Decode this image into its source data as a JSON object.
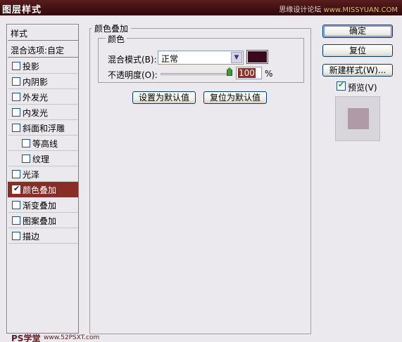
{
  "window": {
    "title": "图层样式",
    "watermark": "思缘设计论坛",
    "watermark_url": "www.MISSYUAN.COM"
  },
  "style_list": {
    "header": "样式",
    "blend_options": "混合选项:自定",
    "items": [
      {
        "label": "投影",
        "checked": false,
        "indent": false,
        "selected": false
      },
      {
        "label": "内阴影",
        "checked": false,
        "indent": false,
        "selected": false
      },
      {
        "label": "外发光",
        "checked": false,
        "indent": false,
        "selected": false
      },
      {
        "label": "内发光",
        "checked": false,
        "indent": false,
        "selected": false
      },
      {
        "label": "斜面和浮雕",
        "checked": false,
        "indent": false,
        "selected": false
      },
      {
        "label": "等高线",
        "checked": false,
        "indent": true,
        "selected": false
      },
      {
        "label": "纹理",
        "checked": false,
        "indent": true,
        "selected": false
      },
      {
        "label": "光泽",
        "checked": false,
        "indent": false,
        "selected": false
      },
      {
        "label": "颜色叠加",
        "checked": true,
        "indent": false,
        "selected": true
      },
      {
        "label": "渐变叠加",
        "checked": false,
        "indent": false,
        "selected": false
      },
      {
        "label": "图案叠加",
        "checked": false,
        "indent": false,
        "selected": false
      },
      {
        "label": "描边",
        "checked": false,
        "indent": false,
        "selected": false
      }
    ],
    "watermark_ps": "PS学堂",
    "watermark_site": "www.52PSXT.com"
  },
  "color_overlay": {
    "group_title": "颜色叠加",
    "color_group_title": "颜色",
    "blend_mode_label": "混合模式(B):",
    "blend_mode_value": "正常",
    "color": "#3a0a20",
    "opacity_label": "不透明度(O):",
    "opacity_value": "100",
    "opacity_unit": "%",
    "set_default_button": "设置为默认值",
    "reset_default_button": "复位为默认值"
  },
  "actions": {
    "ok": "确定",
    "reset": "复位",
    "new_style": "新建样式(W)...",
    "preview_label": "预览(V)",
    "preview_checked": true
  }
}
